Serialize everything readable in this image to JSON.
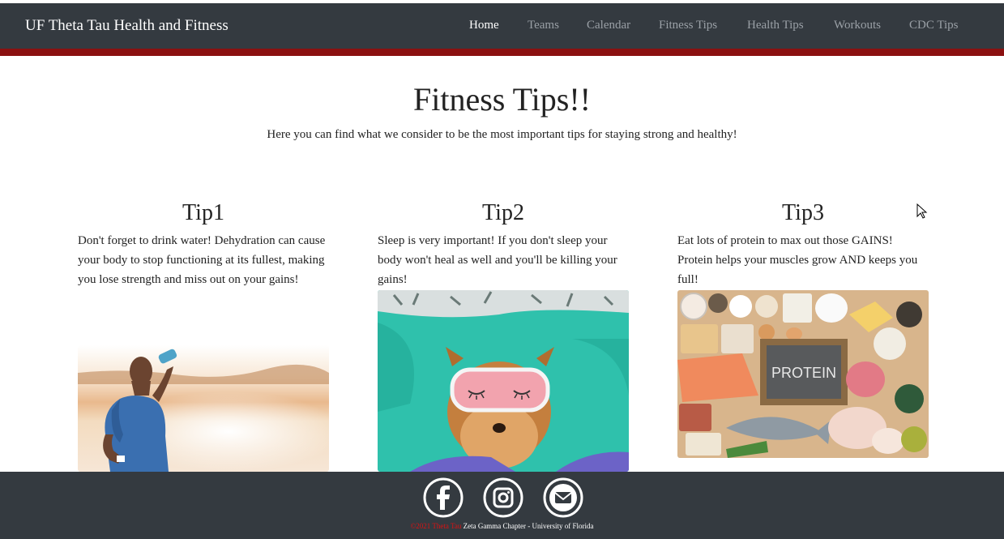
{
  "navbar": {
    "brand": "UF Theta Tau Health and Fitness",
    "items": [
      {
        "label": "Home",
        "active": true
      },
      {
        "label": "Teams",
        "active": false
      },
      {
        "label": "Calendar",
        "active": false
      },
      {
        "label": "Fitness Tips",
        "active": false
      },
      {
        "label": "Health Tips",
        "active": false
      },
      {
        "label": "Workouts",
        "active": false
      },
      {
        "label": "CDC Tips",
        "active": false
      }
    ]
  },
  "hero": {
    "title": "Fitness Tips!!",
    "subtitle": "Here you can find what we consider to be the most important tips for staying strong and healthy!"
  },
  "tips": [
    {
      "title": "Tip1",
      "text": "Don't forget to drink water! Dehydration can cause your body to stop functioning at its fullest, making you lose strength and miss out on your gains!"
    },
    {
      "title": "Tip2",
      "text": "Sleep is very important! If you don't sleep your body won't heal as well and you'll be killing your gains!"
    },
    {
      "title": "Tip3",
      "text": "Eat lots of protein to max out those GAINS! Protein helps your muscles grow AND keeps you full!"
    }
  ],
  "images": {
    "protein_label": "PROTEIN"
  },
  "footer": {
    "social": [
      "facebook-icon",
      "instagram-icon",
      "mail-icon"
    ],
    "copyright_red": "©2021 Theta Tau",
    "copyright_rest": " Zeta Gamma Chapter - University of Florida"
  },
  "colors": {
    "navbar_bg": "#343a40",
    "accent_red": "#8b1010",
    "footer_bg": "#343a40"
  }
}
